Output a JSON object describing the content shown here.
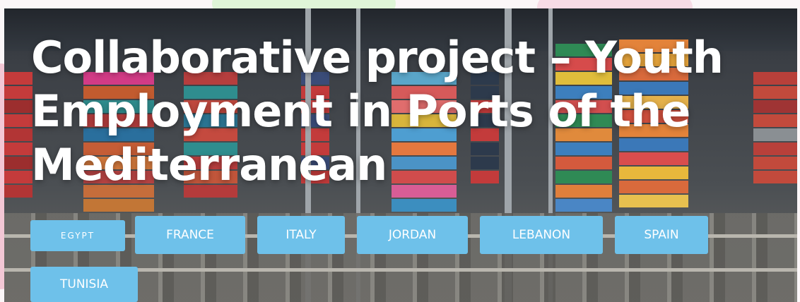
{
  "hero": {
    "title": "Collaborative project – Youth Employment in Ports of the Mediterranean"
  },
  "countries": [
    "EGYPT",
    "FRANCE",
    "ITALY",
    "JORDAN",
    "LEBANON",
    "SPAIN",
    "TUNISIA"
  ],
  "colors": {
    "button_bg": "#6ec1ea",
    "button_text": "#ffffff",
    "title_text": "#ffffff"
  }
}
